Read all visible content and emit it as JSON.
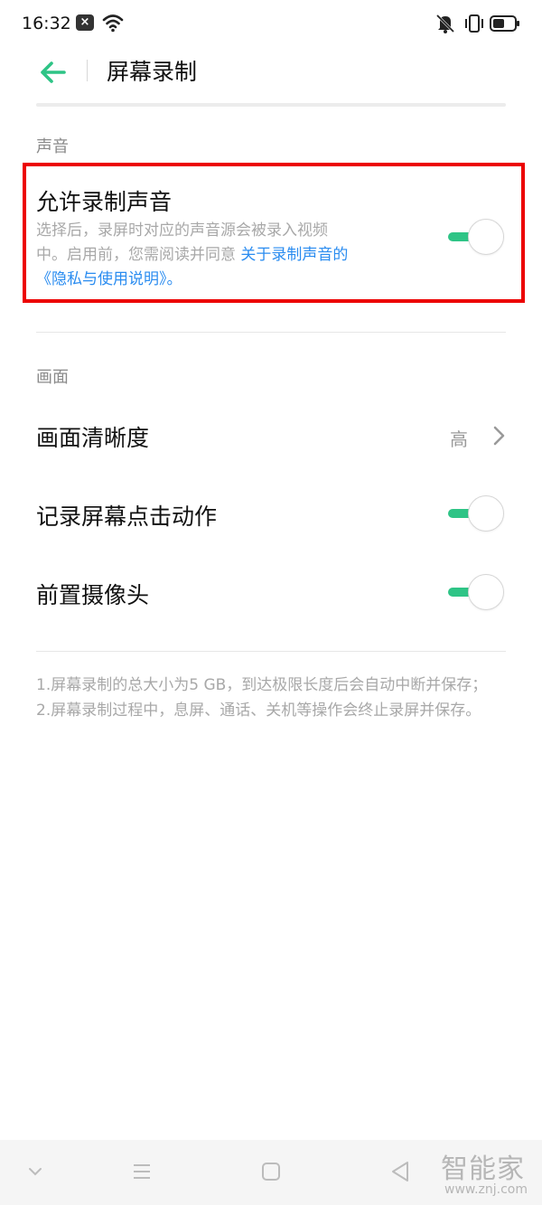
{
  "status_bar": {
    "time": "16:32",
    "icons": [
      "notification-x-icon",
      "wifi-icon",
      "mute-icon",
      "vibrate-icon",
      "battery-icon"
    ]
  },
  "header": {
    "title": "屏幕录制",
    "back_icon": "arrow-left-icon",
    "accent_color": "#2ec486"
  },
  "sound_section": {
    "label": "声音",
    "allow_record": {
      "title": "允许录制声音",
      "desc_line1": "选择后，录屏时对应的声音源会被录入视频",
      "desc_line2": "中。启用前，您需阅读并同意 ",
      "desc_link1": "关于录制声音的",
      "desc_link2": "《隐私与使用说明》",
      "desc_end": "。",
      "toggle_on": true,
      "highlight_color": "#ec0000"
    }
  },
  "screen_section": {
    "label": "画面",
    "clarity": {
      "title": "画面清晰度",
      "value": "高"
    },
    "record_taps": {
      "title": "记录屏幕点击动作",
      "toggle_on": true
    },
    "front_camera": {
      "title": "前置摄像头",
      "toggle_on": true
    }
  },
  "notes": {
    "line1": "1.屏幕录制的总大小为5 GB，到达极限长度后会自动中断并保存；",
    "line2": "2.屏幕录制过程中，息屏、通话、关机等操作会终止录屏并保存。"
  },
  "nav_bar": {
    "icons": [
      "chevron-down-icon",
      "menu-icon",
      "home-icon",
      "back-triangle-icon"
    ]
  },
  "watermark": {
    "brand": "智能家",
    "url": "www.znj.com"
  }
}
